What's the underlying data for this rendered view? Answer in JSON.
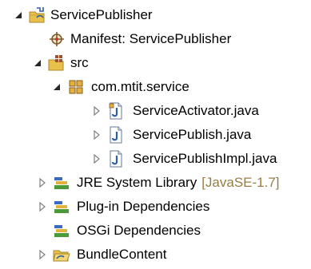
{
  "explorer": {
    "project": {
      "label": "ServicePublisher",
      "icon": "plugin-project-icon",
      "expanded": true
    },
    "manifest": {
      "label": "Manifest: ServicePublisher",
      "icon": "manifest-icon"
    },
    "src": {
      "label": "src",
      "icon": "source-folder-icon",
      "expanded": true
    },
    "package": {
      "label": "com.mtit.service",
      "icon": "package-icon",
      "expanded": true
    },
    "files": [
      {
        "label": "ServiceActivator.java",
        "icon": "java-file-icon"
      },
      {
        "label": "ServicePublish.java",
        "icon": "java-file-icon"
      },
      {
        "label": "ServicePublishImpl.java",
        "icon": "java-file-icon"
      }
    ],
    "libraries": [
      {
        "label": "JRE System Library",
        "decoration": "[JavaSE-1.7]",
        "icon": "library-icon"
      },
      {
        "label": "Plug-in Dependencies",
        "icon": "library-icon"
      },
      {
        "label": "OSGi Dependencies",
        "icon": "library-icon"
      }
    ],
    "bundle": {
      "label": "BundleContent",
      "icon": "linked-folder-icon"
    },
    "colors": {
      "decoration": "#957d47",
      "java_blue": "#2d5fa3",
      "folder_yellow": "#e8c04a"
    }
  }
}
